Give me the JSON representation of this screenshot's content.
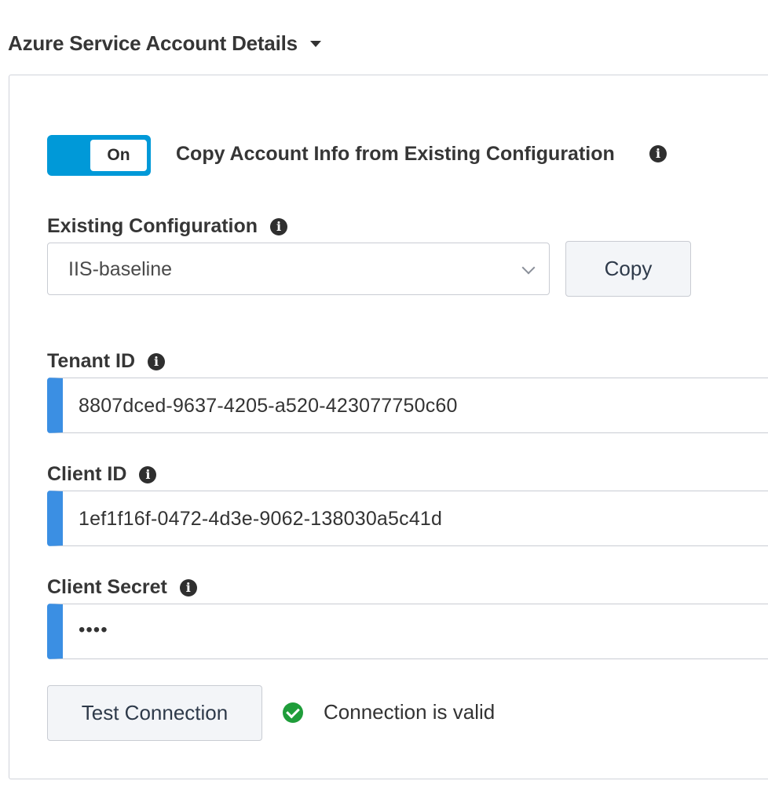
{
  "section": {
    "title": "Azure Service Account Details"
  },
  "toggle": {
    "state_label": "On",
    "label": "Copy Account Info from Existing Configuration"
  },
  "existing_config": {
    "label": "Existing Configuration",
    "selected": "IIS-baseline",
    "copy_button": "Copy"
  },
  "tenant": {
    "label": "Tenant ID",
    "value": "8807dced-9637-4205-a520-423077750c60"
  },
  "client": {
    "label": "Client ID",
    "value": "1ef1f16f-0472-4d3e-9062-138030a5c41d"
  },
  "secret": {
    "label": "Client Secret",
    "value": "••••"
  },
  "test": {
    "button": "Test Connection",
    "status": "Connection is valid"
  },
  "icons": {
    "info": "info-icon",
    "caret": "caret-down-icon",
    "chevron": "chevron-down-icon",
    "status": "check-circle-icon"
  },
  "colors": {
    "toggle_on": "#0099d8",
    "input_accent": "#3b8fe3",
    "success": "#1f9d3a"
  }
}
